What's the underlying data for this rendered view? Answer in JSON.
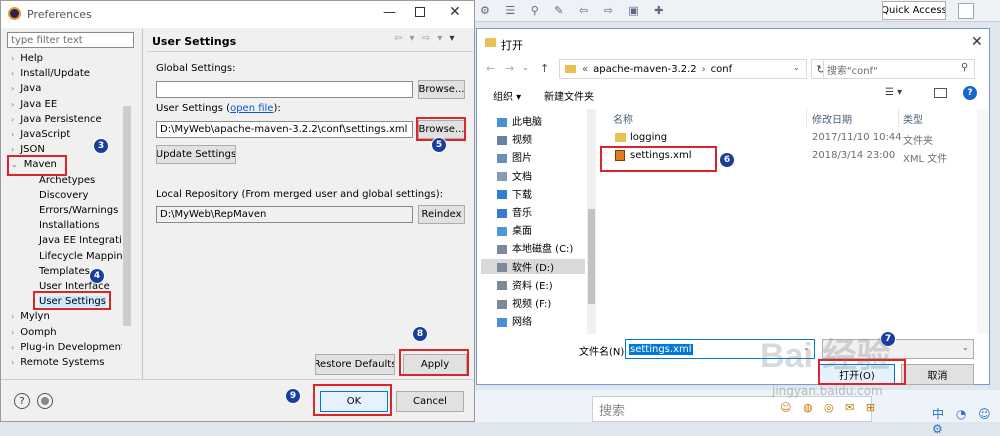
{
  "bg": {
    "quick_access": "Quick Access",
    "search": "搜索"
  },
  "prefs": {
    "title": "Preferences",
    "filter_placeholder": "type filter text",
    "tree": [
      {
        "label": "Help",
        "exp": "›"
      },
      {
        "label": "Install/Update",
        "exp": "›"
      },
      {
        "label": "Java",
        "exp": "›"
      },
      {
        "label": "Java EE",
        "exp": "›"
      },
      {
        "label": "Java Persistence",
        "exp": "›"
      },
      {
        "label": "JavaScript",
        "exp": "›"
      },
      {
        "label": "JSON",
        "exp": "›"
      },
      {
        "label": "Maven",
        "exp": "⌄"
      },
      {
        "label": "Archetypes",
        "exp": ""
      },
      {
        "label": "Discovery",
        "exp": ""
      },
      {
        "label": "Errors/Warnings",
        "exp": ""
      },
      {
        "label": "Installations",
        "exp": ""
      },
      {
        "label": "Java EE Integration",
        "exp": ""
      },
      {
        "label": "Lifecycle Mapping",
        "exp": ""
      },
      {
        "label": "Templates",
        "exp": ""
      },
      {
        "label": "User Interface",
        "exp": ""
      },
      {
        "label": "User Settings",
        "exp": ""
      },
      {
        "label": "Mylyn",
        "exp": "›"
      },
      {
        "label": "Oomph",
        "exp": "›"
      },
      {
        "label": "Plug-in Development",
        "exp": "›"
      },
      {
        "label": "Remote Systems",
        "exp": "›"
      }
    ],
    "page_title": "User Settings",
    "global_label": "Global Settings:",
    "global_value": "",
    "browse1": "Browse...",
    "user_label_pre": "User Settings (",
    "open_file": "open file",
    "user_label_post": "):",
    "user_value": "D:\\MyWeb\\apache-maven-3.2.2\\conf\\settings.xml",
    "browse2": "Browse...",
    "update": "Update Settings",
    "local_label": "Local Repository (From merged user and global settings):",
    "local_value": "D:\\MyWeb\\RepMaven",
    "reindex": "Reindex",
    "restore": "Restore Defaults",
    "apply": "Apply",
    "ok": "OK",
    "cancel": "Cancel"
  },
  "open": {
    "title": "打开",
    "crumbs": [
      "«",
      "apache-maven-3.2.2",
      "›",
      "conf"
    ],
    "search_placeholder": "搜索\"conf\"",
    "organize": "组织 ▾",
    "newfolder": "新建文件夹",
    "nav": [
      "此电脑",
      "视频",
      "图片",
      "文档",
      "下载",
      "音乐",
      "桌面",
      "本地磁盘 (C:)",
      "软件 (D:)",
      "资料 (E:)",
      "视频 (F:)",
      "网络"
    ],
    "cols": {
      "name": "名称",
      "date": "修改日期",
      "type": "类型"
    },
    "files": [
      {
        "name": "logging",
        "date": "2017/11/10 10:44",
        "type": "文件夹",
        "icon": "folder-icon"
      },
      {
        "name": "settings.xml",
        "date": "2018/3/14 23:00",
        "type": "XML 文件",
        "icon": "xml-file-icon"
      }
    ],
    "filename_label": "文件名(N):",
    "filename_value": "settings.xml",
    "filetype_value": "",
    "open_btn": "打开(O)",
    "cancel_btn": "取消"
  },
  "steps": [
    "3",
    "4",
    "5",
    "6",
    "7",
    "8",
    "9"
  ],
  "watermark": {
    "main": "Bai 经验",
    "url": "jingyan.baidu.com"
  },
  "colors": {
    "annotation_red": "#d9262c",
    "step_blue": "#1a3ea0",
    "selection": "#cce8ff",
    "accent": "#0078d7"
  }
}
